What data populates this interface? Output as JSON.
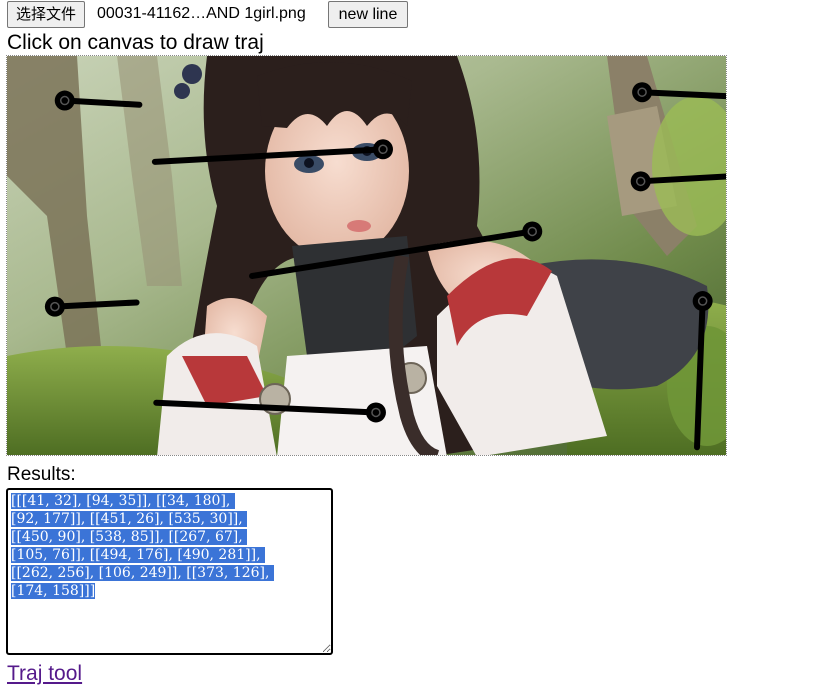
{
  "toolbar": {
    "file_button_label": "选择文件",
    "file_name": "00031-41162…AND 1girl.png",
    "new_line_label": "new line"
  },
  "instructions": "Click on canvas to draw traj",
  "results": {
    "label": "Results:",
    "lines": [
      "[[[41, 32], [94, 35]], [[34, 180], ",
      "[92, 177]], [[451, 26], [535, 30]], ",
      "[[450, 90], [538, 85]], [[267, 67], ",
      "[105, 76]], [[494, 176], [490, 281]], ",
      "[[262, 256], [106, 249]], [[373, 126], ",
      "[174, 158]]]"
    ]
  },
  "link": {
    "label": "Traj tool"
  },
  "colors": {
    "selection": "#3b74d7",
    "link": "#551a8b",
    "stroke": "#000000"
  },
  "canvas": {
    "image": "anime girl lying in forest clearing",
    "trajectories": [
      [
        [
          41,
          32
        ],
        [
          94,
          35
        ]
      ],
      [
        [
          34,
          180
        ],
        [
          92,
          177
        ]
      ],
      [
        [
          451,
          26
        ],
        [
          535,
          30
        ]
      ],
      [
        [
          450,
          90
        ],
        [
          538,
          85
        ]
      ],
      [
        [
          267,
          67
        ],
        [
          105,
          76
        ]
      ],
      [
        [
          494,
          176
        ],
        [
          490,
          281
        ]
      ],
      [
        [
          262,
          256
        ],
        [
          106,
          249
        ]
      ],
      [
        [
          373,
          126
        ],
        [
          174,
          158
        ]
      ]
    ]
  }
}
